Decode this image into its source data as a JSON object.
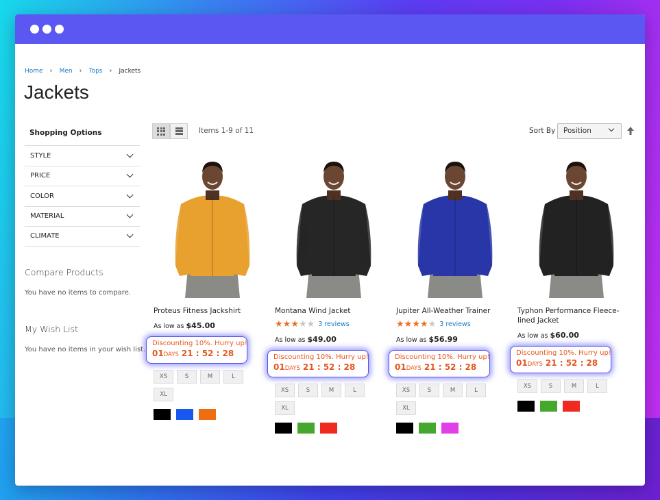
{
  "breadcrumb": [
    "Home",
    "Men",
    "Tops",
    "Jackets"
  ],
  "page_title": "Jackets",
  "sidebar": {
    "title": "Shopping Options",
    "filters": [
      "STYLE",
      "PRICE",
      "COLOR",
      "MATERIAL",
      "CLIMATE"
    ],
    "compare": {
      "title": "Compare Products",
      "text": "You have no items to compare."
    },
    "wishlist": {
      "title": "My Wish List",
      "text": "You have no items in your wish list."
    }
  },
  "toolbar": {
    "amount": "Items 1-9 of 11",
    "sort_label": "Sort By",
    "sort_value": "Position"
  },
  "products": [
    {
      "name": "Proteus Fitness Jackshirt",
      "price_prefix": "As low as",
      "price": "$45.00",
      "rating": 0,
      "reviews": "",
      "timer_text": "Discounting 10%. Hurry up!",
      "days": "01",
      "days_label": "DAYS",
      "time": "21 : 52 : 28",
      "sizes": [
        "XS",
        "S",
        "M",
        "L",
        "XL"
      ],
      "colors": [
        "#000000",
        "#1857f0",
        "#ef6c10"
      ],
      "jacket_color": "#e8a02e"
    },
    {
      "name": "Montana Wind Jacket",
      "price_prefix": "As low as",
      "price": "$49.00",
      "rating": 3,
      "reviews": "3 reviews",
      "timer_text": "Discounting 10%. Hurry up!",
      "days": "01",
      "days_label": "DAYS",
      "time": "21 : 52 : 28",
      "sizes": [
        "XS",
        "S",
        "M",
        "L",
        "XL"
      ],
      "colors": [
        "#000000",
        "#46a72e",
        "#ef2a20"
      ],
      "jacket_color": "#262626"
    },
    {
      "name": "Jupiter All-Weather Trainer",
      "price_prefix": "As low as",
      "price": "$56.99",
      "rating": 4,
      "reviews": "3 reviews",
      "timer_text": "Discounting 10%. Hurry up!",
      "days": "01",
      "days_label": "DAYS",
      "time": "21 : 52 : 28",
      "sizes": [
        "XS",
        "S",
        "M",
        "L",
        "XL"
      ],
      "colors": [
        "#000000",
        "#46a72e",
        "#e040e8"
      ],
      "jacket_color": "#2836a8"
    },
    {
      "name": "Typhon Performance Fleece-lined Jacket",
      "price_prefix": "As low as",
      "price": "$60.00",
      "rating": 0,
      "reviews": "",
      "timer_text": "Discounting 10%. Hurry up!",
      "days": "01",
      "days_label": "DAYS",
      "time": "21 : 52 : 28",
      "sizes": [
        "XS",
        "S",
        "M",
        "L"
      ],
      "colors": [
        "#000000",
        "#46a72e",
        "#ef2a20"
      ],
      "jacket_color": "#222222"
    }
  ]
}
